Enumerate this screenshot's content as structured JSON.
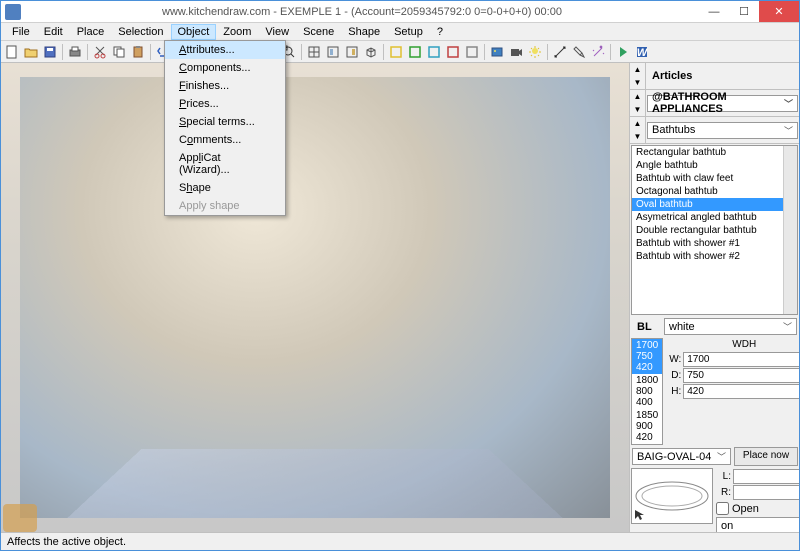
{
  "title": "www.kitchendraw.com - EXEMPLE 1 - (Account=2059345792:0 0=0-0+0+0) 00:00",
  "menus": [
    "File",
    "Edit",
    "Place",
    "Selection",
    "Object",
    "Zoom",
    "View",
    "Scene",
    "Shape",
    "Setup",
    "?"
  ],
  "active_menu_index": 4,
  "dropdown": {
    "items": [
      {
        "label": "Attributes...",
        "u": "A"
      },
      {
        "label": "Components...",
        "u": "C"
      },
      {
        "label": "Finishes...",
        "u": "F"
      },
      {
        "label": "Prices...",
        "u": "P"
      },
      {
        "label": "Special terms...",
        "u": "S"
      },
      {
        "label": "Comments...",
        "u": "o"
      },
      {
        "label": "AppliCat (Wizard)...",
        "u": "l"
      },
      {
        "label": "Shape",
        "u": "h"
      },
      {
        "label": "Apply shape",
        "disabled": true
      }
    ],
    "highlighted": 0
  },
  "sidebar": {
    "header": "Articles",
    "catalog": "@BATHROOM APPLIANCES",
    "category": "Bathtubs",
    "items": [
      "Rectangular bathtub",
      "Angle bathtub",
      "Bathtub with claw feet",
      "Octagonal bathtub",
      "Oval bathtub",
      "Asymetrical angled bathtub",
      "Double rectangular bathtub",
      "Bathtub with shower #1",
      "Bathtub with shower #2"
    ],
    "selected_item_index": 4,
    "bl_label": "BL",
    "bl_value": "white",
    "dims": [
      {
        "w": "1700",
        "d": "750",
        "h": "420",
        "sel": true
      },
      {
        "w": "1800",
        "d": "800",
        "h": "400"
      },
      {
        "w": "1850",
        "d": "900",
        "h": "420"
      }
    ],
    "wdh_header": "WDH",
    "wdh": {
      "W": "1700",
      "D": "750",
      "H": "420"
    },
    "code": "BAIG-OVAL-04",
    "place_label": "Place now",
    "L": "",
    "R": "",
    "open_label": "Open",
    "on_value": "on"
  },
  "statusbar": "Affects the active object."
}
